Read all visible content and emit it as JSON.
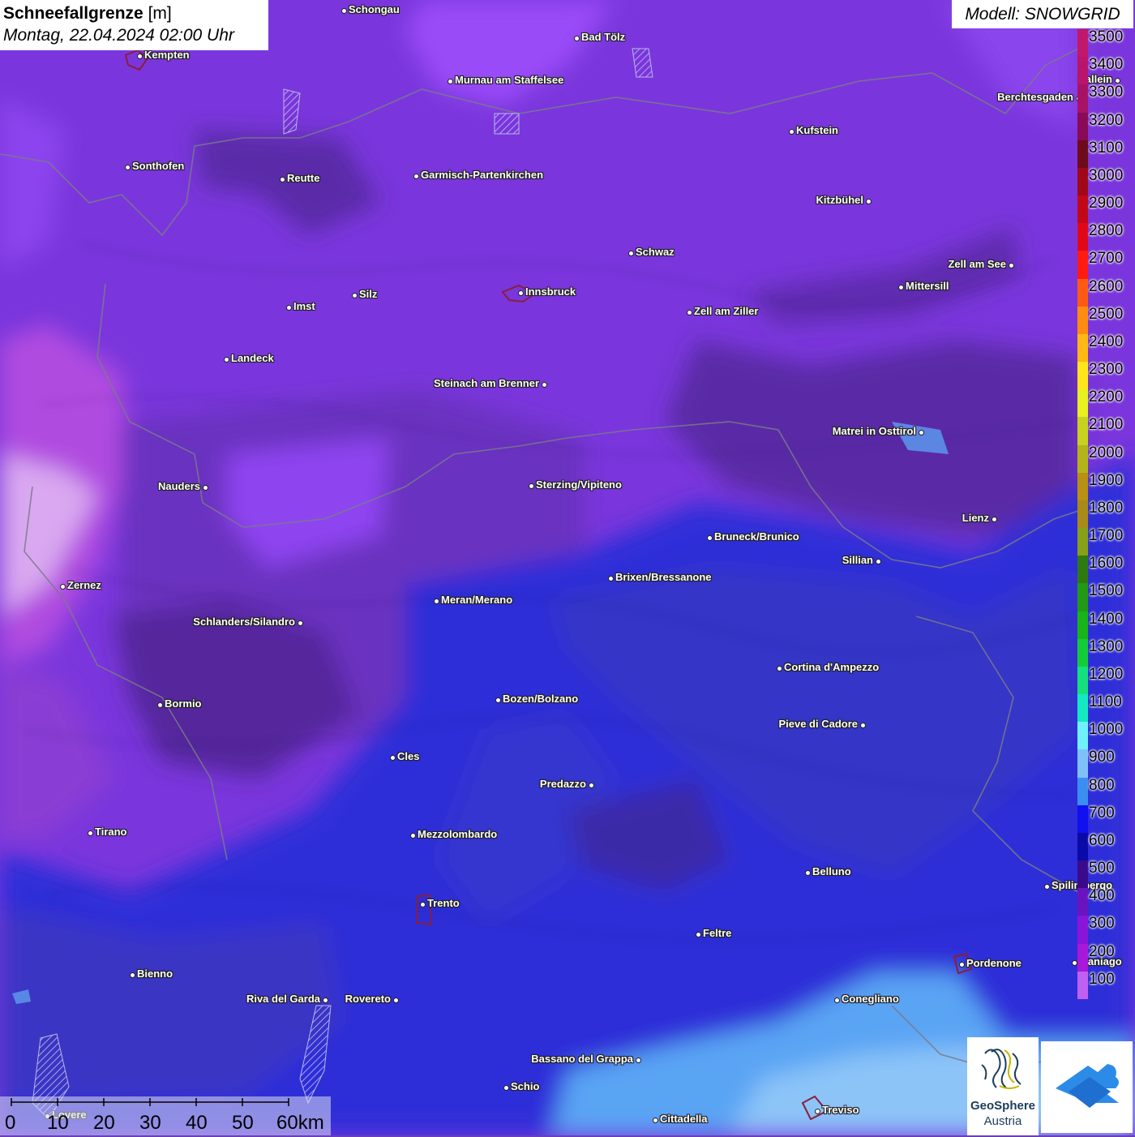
{
  "title": {
    "label": "Schneefallgrenze",
    "unit": "[m]",
    "datetime": "Montag, 22.04.2024 02:00 Uhr"
  },
  "model": "Modell: SNOWGRID",
  "legend": {
    "levels": [
      {
        "value": "3500",
        "color": "#c2186b"
      },
      {
        "value": "3400",
        "color": "#b8156b"
      },
      {
        "value": "3300",
        "color": "#a81265"
      },
      {
        "value": "3200",
        "color": "#8a0a55"
      },
      {
        "value": "3100",
        "color": "#6e0a1a"
      },
      {
        "value": "3000",
        "color": "#a00818"
      },
      {
        "value": "2900",
        "color": "#c00818"
      },
      {
        "value": "2800",
        "color": "#e00818"
      },
      {
        "value": "2700",
        "color": "#ff1a12"
      },
      {
        "value": "2600",
        "color": "#ff5a14"
      },
      {
        "value": "2500",
        "color": "#ff8c10"
      },
      {
        "value": "2400",
        "color": "#ffb814"
      },
      {
        "value": "2300",
        "color": "#ffe61a"
      },
      {
        "value": "2200",
        "color": "#e8f020"
      },
      {
        "value": "2100",
        "color": "#c8d21e"
      },
      {
        "value": "2000",
        "color": "#b4b41a"
      },
      {
        "value": "1900",
        "color": "#b89012"
      },
      {
        "value": "1800",
        "color": "#a88a18"
      },
      {
        "value": "1700",
        "color": "#88a018"
      },
      {
        "value": "1600",
        "color": "#2e7a10"
      },
      {
        "value": "1500",
        "color": "#229a14"
      },
      {
        "value": "1400",
        "color": "#18b418"
      },
      {
        "value": "1300",
        "color": "#14cc3a"
      },
      {
        "value": "1200",
        "color": "#14e07e"
      },
      {
        "value": "1100",
        "color": "#14e8c0"
      },
      {
        "value": "1000",
        "color": "#70f0f8"
      },
      {
        "value": "900",
        "color": "#80c0f8"
      },
      {
        "value": "800",
        "color": "#3a8ef0"
      },
      {
        "value": "700",
        "color": "#1010f0"
      },
      {
        "value": "600",
        "color": "#0a0aa8"
      },
      {
        "value": "500",
        "color": "#3a0a8a"
      },
      {
        "value": "400",
        "color": "#6a14c0"
      },
      {
        "value": "300",
        "color": "#8a14d8"
      },
      {
        "value": "200",
        "color": "#a818d8"
      },
      {
        "value": "100",
        "color": "#c060f0"
      }
    ]
  },
  "cities": [
    {
      "name": "Schongau"
    },
    {
      "name": "Bad Tölz"
    },
    {
      "name": "Kempten"
    },
    {
      "name": "Murnau am Staffelsee"
    },
    {
      "name": "Hallein"
    },
    {
      "name": "Berchtesgaden"
    },
    {
      "name": "Kufstein"
    },
    {
      "name": "Sonthofen"
    },
    {
      "name": "Reutte"
    },
    {
      "name": "Garmisch-Partenkirchen"
    },
    {
      "name": "Kitzbühel"
    },
    {
      "name": "Schwaz"
    },
    {
      "name": "Zell am See"
    },
    {
      "name": "Mittersill"
    },
    {
      "name": "Innsbruck"
    },
    {
      "name": "Silz"
    },
    {
      "name": "Imst"
    },
    {
      "name": "Zell am Ziller"
    },
    {
      "name": "Landeck"
    },
    {
      "name": "Steinach am Brenner"
    },
    {
      "name": "Matrei in Osttirol"
    },
    {
      "name": "Nauders"
    },
    {
      "name": "Sterzing/Vipiteno"
    },
    {
      "name": "Lienz"
    },
    {
      "name": "Bruneck/Brunico"
    },
    {
      "name": "Sillian"
    },
    {
      "name": "Brixen/Bressanone"
    },
    {
      "name": "Zernez"
    },
    {
      "name": "Meran/Merano"
    },
    {
      "name": "Schlanders/Silandro"
    },
    {
      "name": "Cortina d'Ampezzo"
    },
    {
      "name": "Bozen/Bolzano"
    },
    {
      "name": "Bormio"
    },
    {
      "name": "Pieve di Cadore"
    },
    {
      "name": "Cles"
    },
    {
      "name": "Predazzo"
    },
    {
      "name": "Tirano"
    },
    {
      "name": "Mezzolombardo"
    },
    {
      "name": "Belluno"
    },
    {
      "name": "Spilimbergo"
    },
    {
      "name": "Trento"
    },
    {
      "name": "Feltre"
    },
    {
      "name": "Pordenone"
    },
    {
      "name": "Maniago"
    },
    {
      "name": "Bienno"
    },
    {
      "name": "Riva del Garda"
    },
    {
      "name": "Rovereto"
    },
    {
      "name": "Conegliano"
    },
    {
      "name": "Bassano del Grappa"
    },
    {
      "name": "Schio"
    },
    {
      "name": "Lovere"
    },
    {
      "name": "Treviso"
    },
    {
      "name": "Cittadella"
    }
  ],
  "scale_bar": {
    "labels": [
      "0",
      "10",
      "20",
      "30",
      "40",
      "50",
      "60km"
    ]
  },
  "logos": {
    "geosphere_line1": "GeoSphere",
    "geosphere_line2": "Austria"
  }
}
